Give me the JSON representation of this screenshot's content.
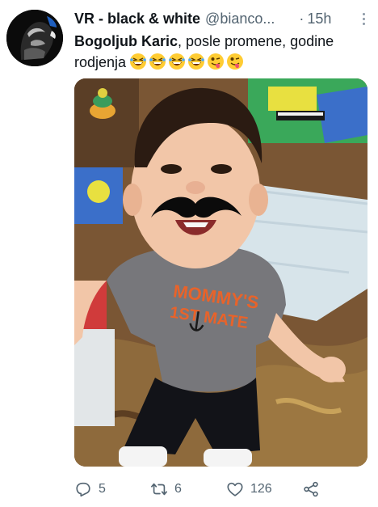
{
  "tweet": {
    "display_name": "VR - black & white",
    "handle": "@bianco...",
    "separator": "·",
    "time": "15h",
    "text_bold": "Bogoljub Karic",
    "text_rest": ", posle promene, godine rodjenja",
    "emojis": [
      "grinning-squinting-face-emoji",
      "grinning-squinting-face-emoji",
      "grinning-squinting-face-emoji",
      "grinning-squinting-face-emoji",
      "winking-face-with-tongue-emoji",
      "winking-face-with-tongue-emoji"
    ],
    "photo_shirt_text": [
      "MOMMY'S",
      "1ST MATE"
    ]
  },
  "actions": {
    "reply_count": "5",
    "retweet_count": "6",
    "like_count": "126"
  },
  "colors": {
    "text_primary": "#0f1419",
    "text_secondary": "#536471"
  },
  "icons": [
    "more-icon",
    "reply-icon",
    "retweet-icon",
    "like-icon",
    "share-icon"
  ]
}
